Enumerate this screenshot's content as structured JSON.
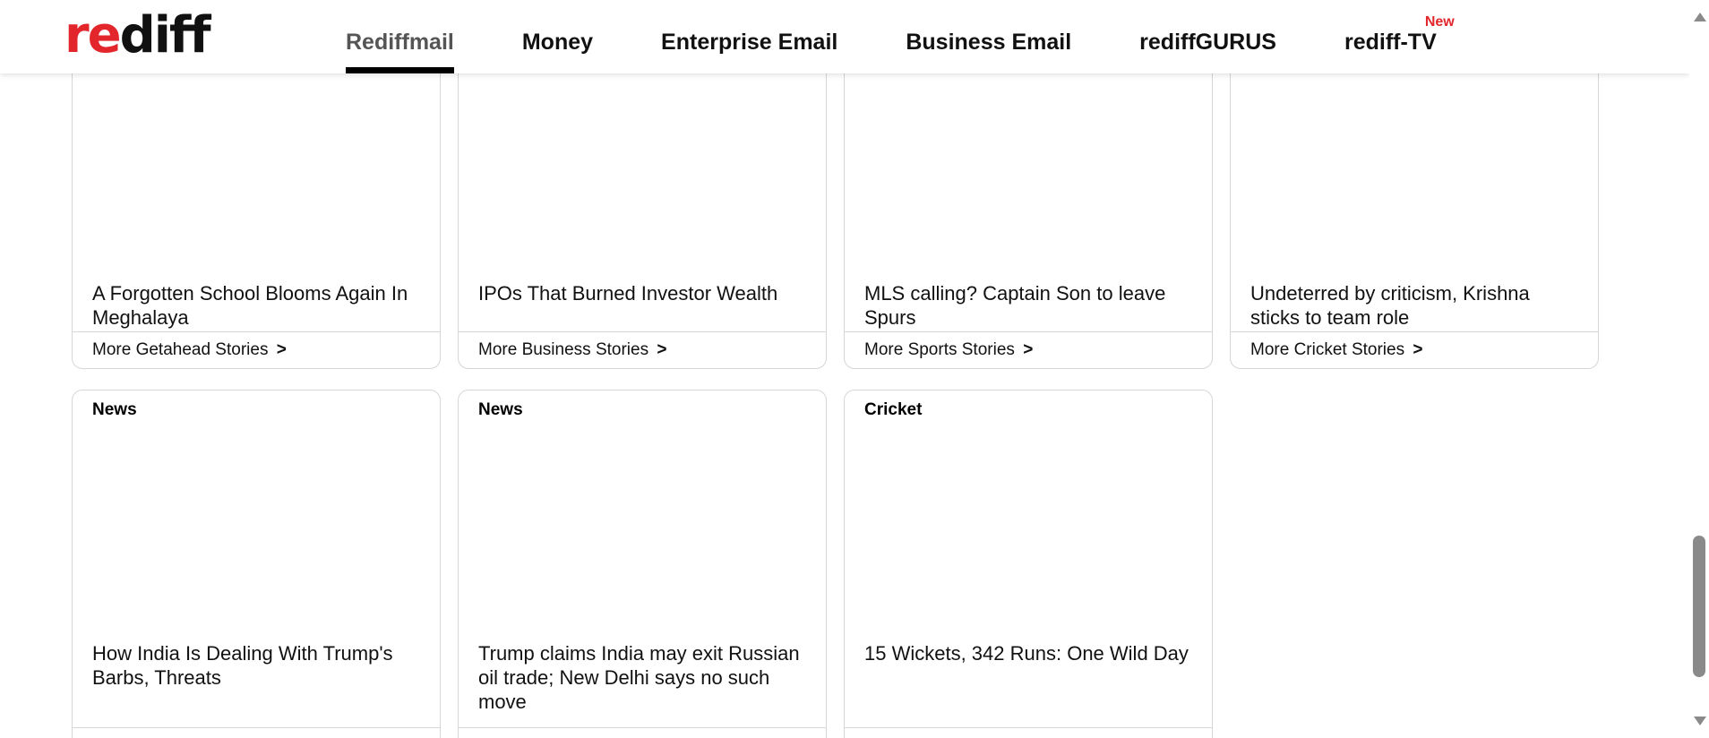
{
  "header": {
    "logo": {
      "part1": "re",
      "part2": "diff"
    },
    "nav": [
      {
        "label": "Rediffmail",
        "active": true
      },
      {
        "label": "Money"
      },
      {
        "label": "Enterprise Email"
      },
      {
        "label": "Business Email"
      },
      {
        "label": "rediffGURUS"
      },
      {
        "label": "rediff-TV",
        "badge": "New"
      }
    ]
  },
  "cards_top": [
    {
      "headline": "A Forgotten School Blooms Again In Meghalaya",
      "footer": "More Getahead Stories",
      "chevron": ">"
    },
    {
      "headline": "IPOs That Burned Investor Wealth",
      "footer": "More Business Stories",
      "chevron": ">"
    },
    {
      "headline": "MLS calling? Captain Son to leave Spurs",
      "footer": "More Sports Stories",
      "chevron": ">"
    },
    {
      "headline": "Undeterred by criticism, Krishna sticks to team role",
      "footer": "More Cricket Stories",
      "chevron": ">"
    }
  ],
  "cards_bottom": [
    {
      "category": "News",
      "headline": "How India Is Dealing With Trump's Barbs, Threats"
    },
    {
      "category": "News",
      "headline": "Trump claims India may exit Russian oil trade; New Delhi says no such move"
    },
    {
      "category": "Cricket",
      "headline": "15 Wickets, 342 Runs: One Wild Day"
    }
  ],
  "colors": {
    "brand_red": "#e2262b",
    "active_tab_underline": "#000000",
    "card_border": "#d6d6d6",
    "scrollbar": "#8a8a8a"
  }
}
